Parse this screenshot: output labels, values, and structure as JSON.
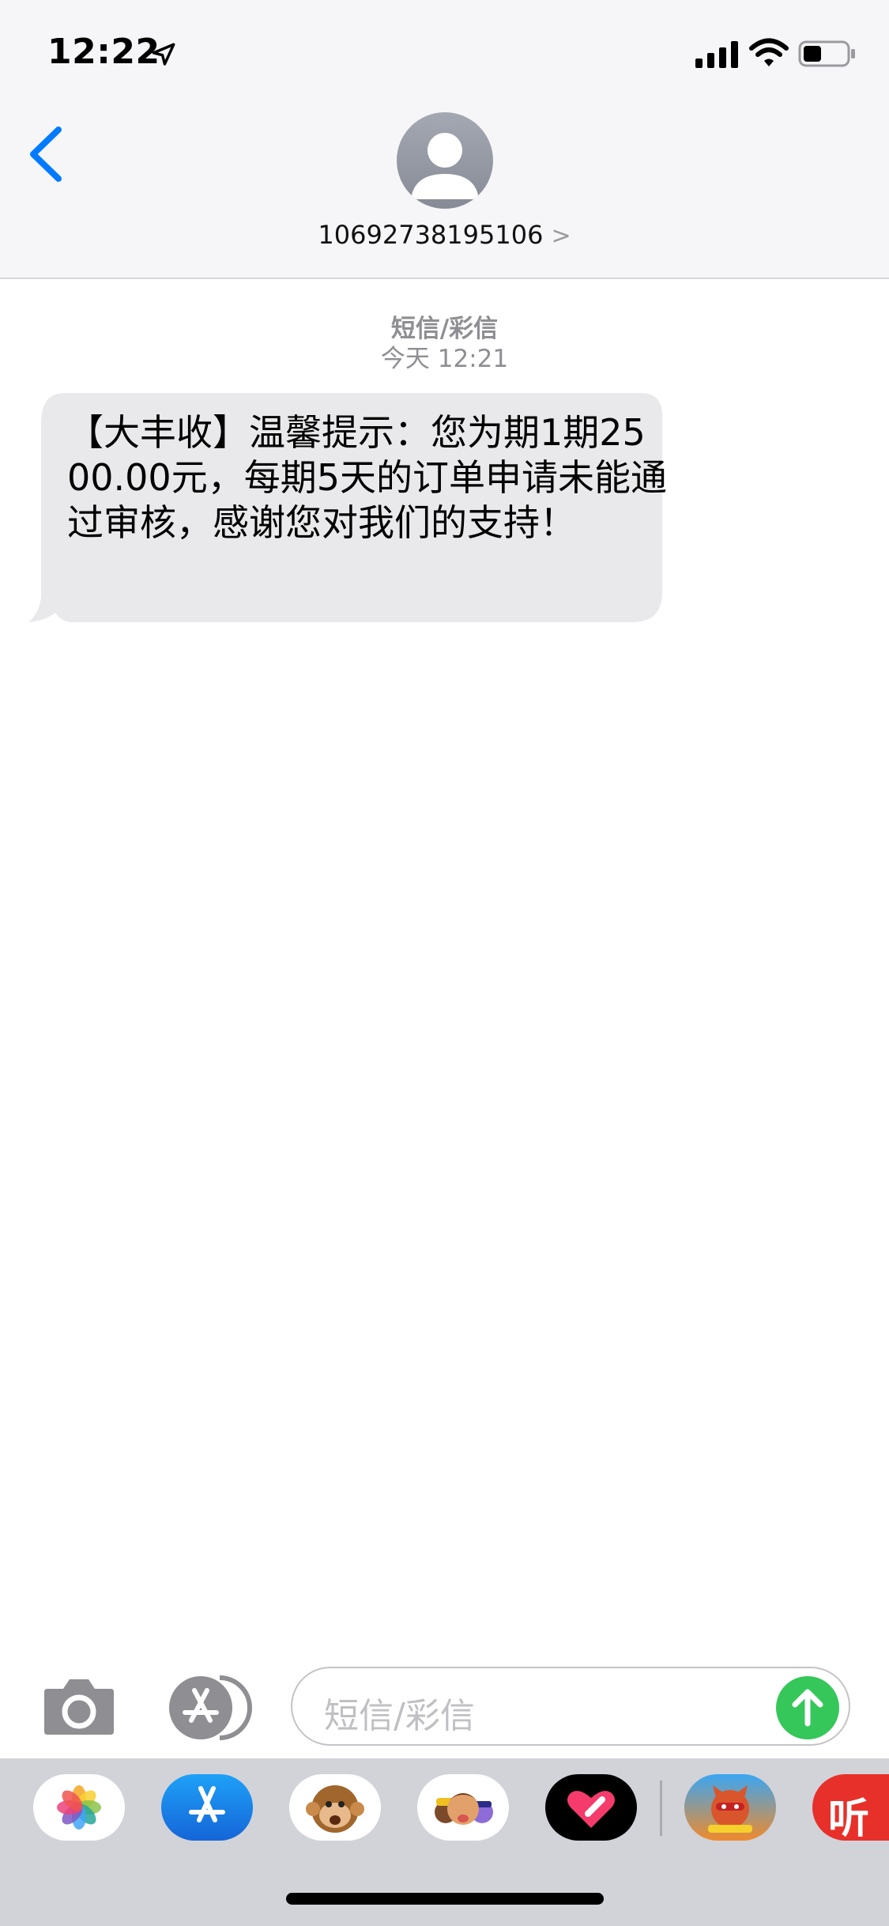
{
  "status_bar": {
    "time": "12:22"
  },
  "header": {
    "contact": "10692738195106",
    "contact_chevron": ">"
  },
  "conversation": {
    "message_type": "短信/彩信",
    "timestamp": "今天 12:21",
    "messages": [
      {
        "direction": "incoming",
        "text": "【大丰收】温馨提示：您为期1期2500.00元，每期5天的订单申请未能通过审核，感谢您对我们的支持！"
      }
    ]
  },
  "compose": {
    "placeholder": "短信/彩信"
  },
  "app_drawer": {
    "items": [
      {
        "icon": "photos-icon"
      },
      {
        "icon": "app-store-icon"
      },
      {
        "icon": "animoji-icon"
      },
      {
        "icon": "memoji-icon"
      },
      {
        "icon": "digital-touch-icon"
      },
      {
        "icon": "game-icon"
      },
      {
        "icon": "listen-app-icon",
        "label": "听"
      }
    ]
  },
  "colors": {
    "accent_blue": "#007aff",
    "send_green": "#35c759",
    "bubble_gray": "#e9e9eb",
    "header_bg": "#f6f6f8",
    "drawer_bg": "#d1d3d9"
  }
}
